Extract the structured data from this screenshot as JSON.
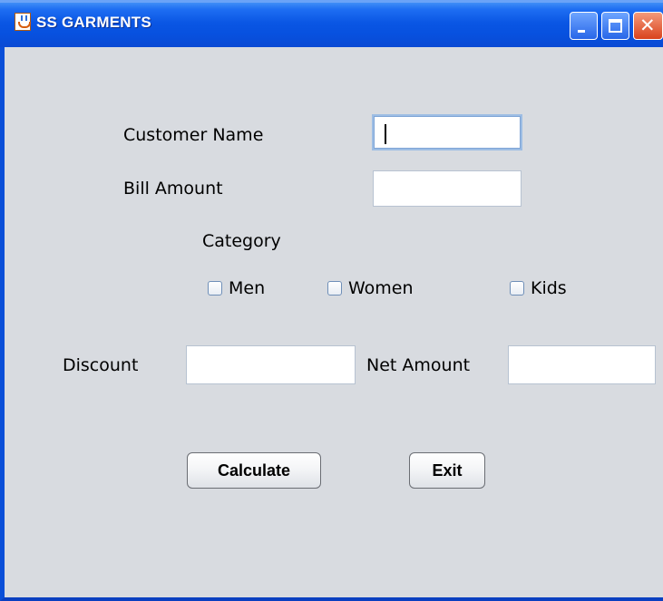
{
  "window": {
    "title": "SS GARMENTS",
    "icon": "java-cup-icon",
    "controls": {
      "minimize": "minimize-icon",
      "maximize": "maximize-icon",
      "close": "close-icon",
      "close_glyph": "✕"
    }
  },
  "form": {
    "customer_name_label": "Customer Name",
    "customer_name_value": "",
    "bill_amount_label": "Bill Amount",
    "bill_amount_value": "",
    "category_label": "Category",
    "categories": [
      {
        "label": "Men",
        "checked": false
      },
      {
        "label": "Women",
        "checked": false
      },
      {
        "label": "Kids",
        "checked": false
      }
    ],
    "discount_label": "Discount",
    "discount_value": "",
    "net_amount_label": "Net Amount",
    "net_amount_value": ""
  },
  "buttons": {
    "calculate": "Calculate",
    "exit": "Exit"
  }
}
